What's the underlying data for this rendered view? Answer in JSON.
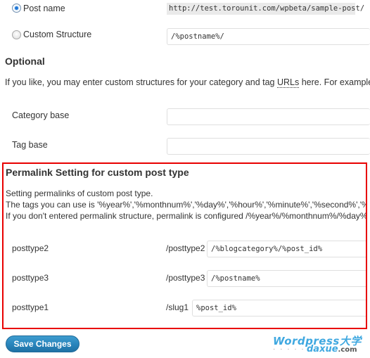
{
  "permalink_options": [
    {
      "label": "Post name",
      "checked": true,
      "sample": "http://test.torounit.com/wpbeta/sample-post/"
    },
    {
      "label": "Custom Structure",
      "checked": false,
      "value": "/%postname%/"
    }
  ],
  "optional": {
    "heading": "Optional",
    "description_before": "If you like, you may enter custom structures for your category and tag ",
    "description_abbr": "URLs",
    "description_after": " here. For example, u",
    "fields": [
      {
        "label": "Category base",
        "value": "",
        "placeholder": ""
      },
      {
        "label": "Tag base",
        "value": "",
        "placeholder": ""
      }
    ]
  },
  "custom_post_type": {
    "heading": "Permalink Setting for custom post type",
    "lines": [
      "Setting permalinks of custom post type.",
      "The tags you can use is '%year%','%monthnum%','%day%','%hour%','%minute%','%second%','%",
      "If you don't entered permalink structure, permalink is configured /%year%/%monthnum%/%day%"
    ],
    "rows": [
      {
        "label": "posttype2",
        "prefix": "/posttype2",
        "value": "/%blogcategory%/%post_id%"
      },
      {
        "label": "posttype3",
        "prefix": "/posttype3",
        "value": "/%postname%"
      },
      {
        "label": "posttype1",
        "prefix": "/slug1",
        "value": "%post_id%"
      }
    ]
  },
  "save_button": {
    "label": "Save Changes"
  },
  "watermark": {
    "line1": "Wordpress大学",
    "line2": "daxue",
    "line2_suffix": ".com"
  },
  "colors": {
    "highlight_border": "#e80000",
    "button": "#2a86bd",
    "watermark": "#3fa8e0"
  }
}
